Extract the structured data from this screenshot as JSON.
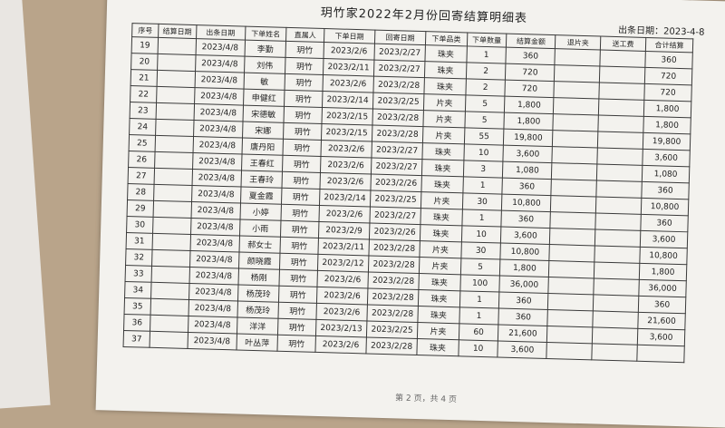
{
  "doc": {
    "title": "玥竹家2022年2月份回寄结算明细表",
    "date_label": "出条日期：2023-4-8",
    "footer": "第 2 页，共 4 页",
    "headers": [
      "序号",
      "结算日期",
      "出条日期",
      "下单姓名",
      "直属人",
      "下单日期",
      "回寄日期",
      "下单品类",
      "下单数量",
      "结算金额",
      "退片夹",
      "送工费",
      "合计结算"
    ],
    "rows": [
      [
        "19",
        "",
        "2023/4/8",
        "李勤",
        "玥竹",
        "2023/2/6",
        "2023/2/27",
        "珠夹",
        "1",
        "360",
        "",
        "",
        "360"
      ],
      [
        "20",
        "",
        "2023/4/8",
        "刘伟",
        "玥竹",
        "2023/2/11",
        "2023/2/27",
        "珠夹",
        "2",
        "720",
        "",
        "",
        "720"
      ],
      [
        "21",
        "",
        "2023/4/8",
        "敏",
        "玥竹",
        "2023/2/6",
        "2023/2/28",
        "珠夹",
        "2",
        "720",
        "",
        "",
        "720"
      ],
      [
        "22",
        "",
        "2023/4/8",
        "申健红",
        "玥竹",
        "2023/2/14",
        "2023/2/25",
        "片夹",
        "5",
        "1,800",
        "",
        "",
        "1,800"
      ],
      [
        "23",
        "",
        "2023/4/8",
        "宋德敏",
        "玥竹",
        "2023/2/15",
        "2023/2/28",
        "片夹",
        "5",
        "1,800",
        "",
        "",
        "1,800"
      ],
      [
        "24",
        "",
        "2023/4/8",
        "宋娜",
        "玥竹",
        "2023/2/15",
        "2023/2/28",
        "片夹",
        "55",
        "19,800",
        "",
        "",
        "19,800"
      ],
      [
        "25",
        "",
        "2023/4/8",
        "唐丹阳",
        "玥竹",
        "2023/2/6",
        "2023/2/27",
        "珠夹",
        "10",
        "3,600",
        "",
        "",
        "3,600"
      ],
      [
        "26",
        "",
        "2023/4/8",
        "王春红",
        "玥竹",
        "2023/2/6",
        "2023/2/27",
        "珠夹",
        "3",
        "1,080",
        "",
        "",
        "1,080"
      ],
      [
        "27",
        "",
        "2023/4/8",
        "王春玲",
        "玥竹",
        "2023/2/6",
        "2023/2/26",
        "珠夹",
        "1",
        "360",
        "",
        "",
        "360"
      ],
      [
        "28",
        "",
        "2023/4/8",
        "夏金霞",
        "玥竹",
        "2023/2/14",
        "2023/2/25",
        "片夹",
        "30",
        "10,800",
        "",
        "",
        "10,800"
      ],
      [
        "29",
        "",
        "2023/4/8",
        "小婷",
        "玥竹",
        "2023/2/6",
        "2023/2/27",
        "珠夹",
        "1",
        "360",
        "",
        "",
        "360"
      ],
      [
        "30",
        "",
        "2023/4/8",
        "小雨",
        "玥竹",
        "2023/2/9",
        "2023/2/26",
        "珠夹",
        "10",
        "3,600",
        "",
        "",
        "3,600"
      ],
      [
        "31",
        "",
        "2023/4/8",
        "郝女士",
        "玥竹",
        "2023/2/11",
        "2023/2/28",
        "片夹",
        "30",
        "10,800",
        "",
        "",
        "10,800"
      ],
      [
        "32",
        "",
        "2023/4/8",
        "颜晓霞",
        "玥竹",
        "2023/2/12",
        "2023/2/28",
        "片夹",
        "5",
        "1,800",
        "",
        "",
        "1,800"
      ],
      [
        "33",
        "",
        "2023/4/8",
        "杨刚",
        "玥竹",
        "2023/2/6",
        "2023/2/28",
        "珠夹",
        "100",
        "36,000",
        "",
        "",
        "36,000"
      ],
      [
        "34",
        "",
        "2023/4/8",
        "杨茂玲",
        "玥竹",
        "2023/2/6",
        "2023/2/28",
        "珠夹",
        "1",
        "360",
        "",
        "",
        "360"
      ],
      [
        "35",
        "",
        "2023/4/8",
        "杨茂玲",
        "玥竹",
        "2023/2/6",
        "2023/2/28",
        "珠夹",
        "1",
        "360",
        "",
        "",
        "21,600"
      ],
      [
        "36",
        "",
        "2023/4/8",
        "洋洋",
        "玥竹",
        "2023/2/13",
        "2023/2/25",
        "片夹",
        "60",
        "21,600",
        "",
        "",
        "3,600"
      ],
      [
        "37",
        "",
        "2023/4/8",
        "叶丛萍",
        "玥竹",
        "2023/2/6",
        "2023/2/28",
        "珠夹",
        "10",
        "3,600",
        "",
        "",
        ""
      ]
    ]
  }
}
